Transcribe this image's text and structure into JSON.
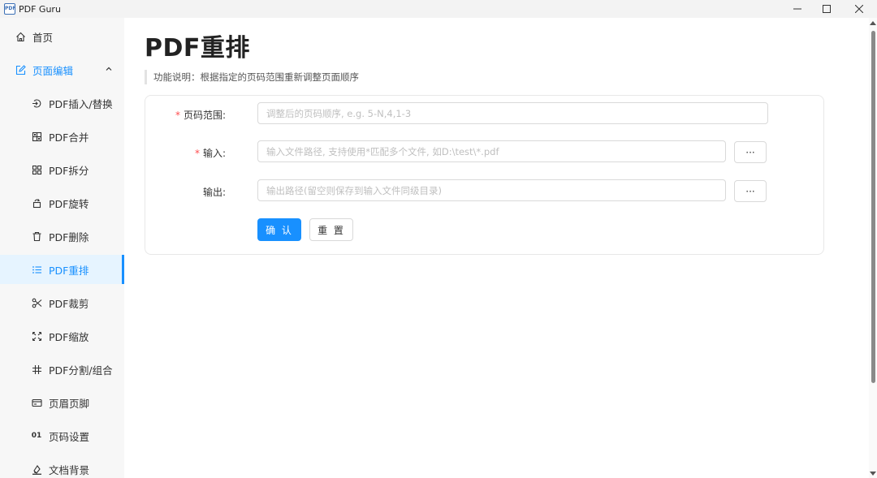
{
  "window": {
    "app_icon_text": "PDF",
    "title": "PDF Guru"
  },
  "sidebar": {
    "home": {
      "label": "首页",
      "icon": "home-icon"
    },
    "group": {
      "label": "页面编辑",
      "icon": "edit-icon",
      "expanded": true
    },
    "items": [
      {
        "label": "PDF插入/替换",
        "icon": "insert-icon"
      },
      {
        "label": "PDF合并",
        "icon": "merge-icon"
      },
      {
        "label": "PDF拆分",
        "icon": "split-icon"
      },
      {
        "label": "PDF旋转",
        "icon": "rotate-icon"
      },
      {
        "label": "PDF删除",
        "icon": "delete-icon"
      },
      {
        "label": "PDF重排",
        "icon": "list-icon",
        "active": true
      },
      {
        "label": "PDF裁剪",
        "icon": "scissors-icon"
      },
      {
        "label": "PDF缩放",
        "icon": "scale-icon"
      },
      {
        "label": "PDF分割/组合",
        "icon": "grid-icon"
      },
      {
        "label": "页眉页脚",
        "icon": "header-footer-icon"
      },
      {
        "label": "页码设置",
        "icon": "page-number-icon",
        "icon_text": "01"
      },
      {
        "label": "文档背景",
        "icon": "background-icon"
      }
    ]
  },
  "main": {
    "title": "PDF重排",
    "description": "功能说明：根据指定的页码范围重新调整页面顺序",
    "form": {
      "page_range": {
        "label": "页码范围:",
        "required": true,
        "value": "",
        "placeholder": "调整后的页码顺序, e.g. 5-N,4,1-3"
      },
      "input": {
        "label": "输入:",
        "required": true,
        "value": "",
        "placeholder": "输入文件路径, 支持使用*匹配多个文件, 如D:\\test\\*.pdf",
        "browse_label": "···"
      },
      "output": {
        "label": "输出:",
        "required": false,
        "value": "",
        "placeholder": "输出路径(留空则保存到输入文件同级目录)",
        "browse_label": "···"
      },
      "confirm_label": "确 认",
      "reset_label": "重 置"
    }
  },
  "colors": {
    "accent": "#1890ff",
    "required": "#ff4d4f",
    "active_bg": "#e6f4ff",
    "sidebar_bg": "#f7f7f7"
  }
}
